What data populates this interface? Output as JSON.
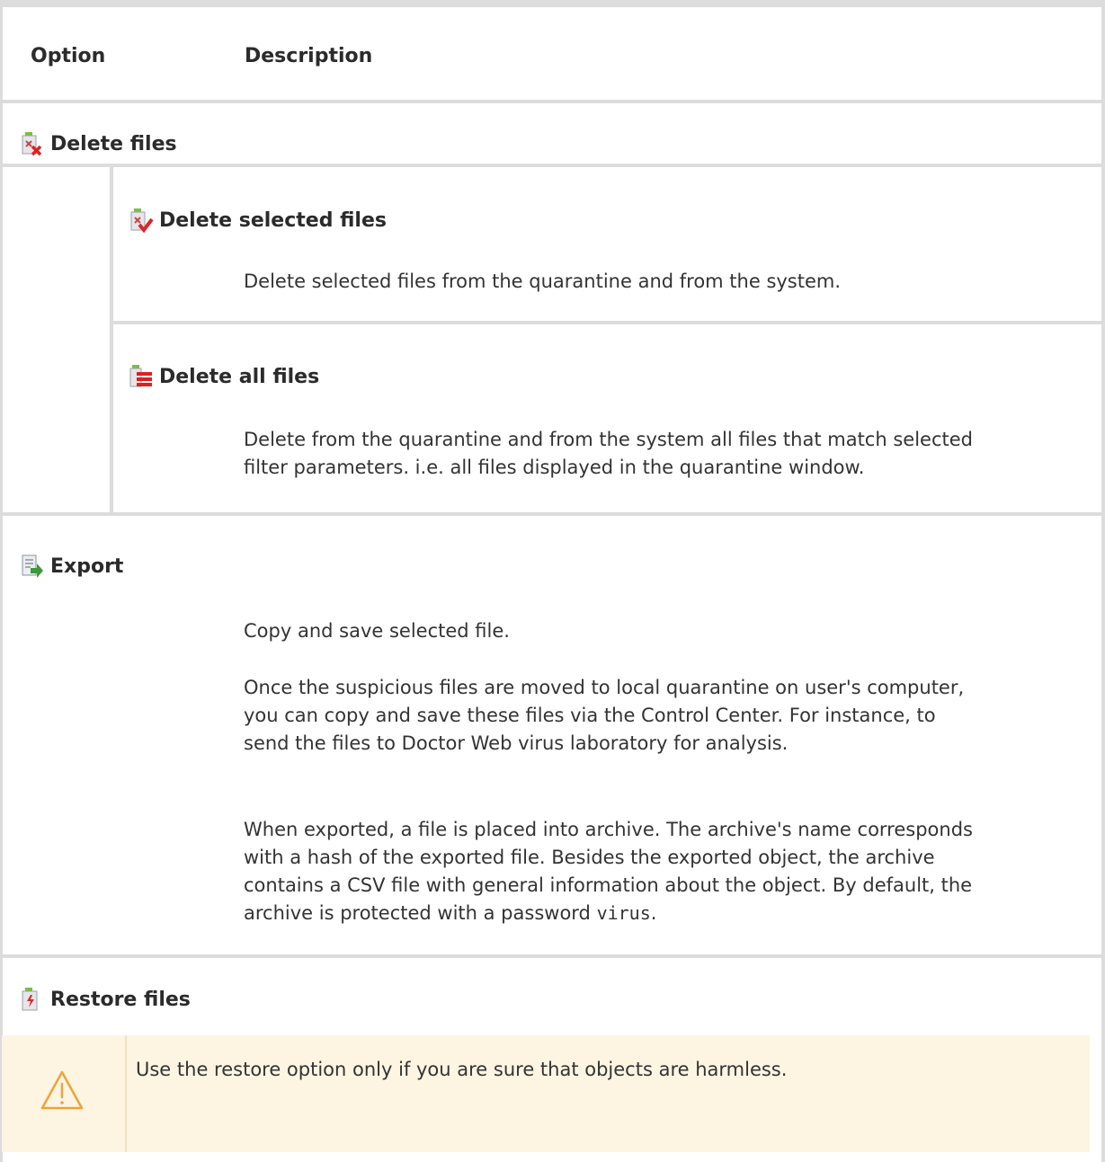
{
  "header": {
    "option_label": "Option",
    "description_label": "Description"
  },
  "sections": {
    "delete_files": {
      "title": "Delete files",
      "icon": "delete-files-icon",
      "items": [
        {
          "title": "Delete selected files",
          "icon": "delete-selected-files-icon",
          "description": "Delete selected files from the quarantine and from the system."
        },
        {
          "title": "Delete all files",
          "icon": "delete-all-files-icon",
          "description_line1": "Delete from the quarantine and from the system all files that match selected",
          "description_line2": "filter parameters. i.e. all files displayed in the quarantine window."
        }
      ]
    },
    "export": {
      "title": "Export",
      "icon": "export-icon",
      "para1": "Copy and save selected file.",
      "para2_lines": [
        "Once the suspicious files are moved to local quarantine on user's computer,",
        "you can copy and save these files via the Control Center. For instance, to",
        "send the files to Doctor Web virus laboratory for analysis."
      ],
      "para3_lines": [
        "When exported, a file is placed into archive. The archive's name corresponds",
        "with a hash of the exported file. Besides the exported object, the archive",
        "contains a CSV file with general information about the object. By default, the"
      ],
      "para3_last_prefix": "archive is protected with a password ",
      "password": "virus",
      "para3_last_suffix": "."
    },
    "restore_files": {
      "title": "Restore files",
      "icon": "restore-files-icon",
      "warning": "Use the restore option only if you are sure that objects are harmless.",
      "warning_icon": "warning-triangle-icon"
    }
  },
  "colors": {
    "border": "#dcdcdc",
    "warning_bg": "#fdf5e2",
    "warning_icon": "#f0a23a",
    "text": "#333333"
  }
}
